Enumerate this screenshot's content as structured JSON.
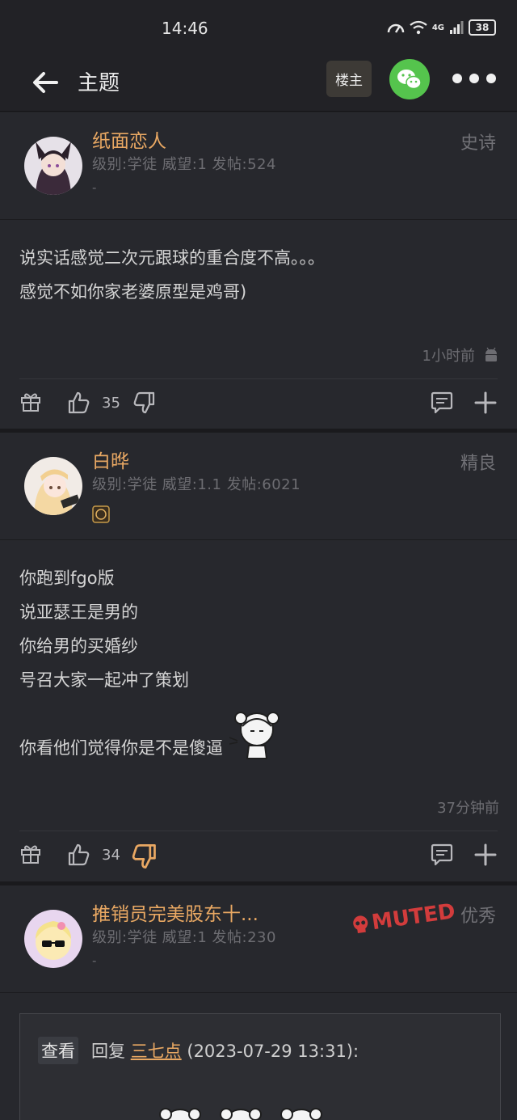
{
  "status_bar": {
    "time": "14:46",
    "network": "4G",
    "battery": "38"
  },
  "header": {
    "title": "主题",
    "op_button": "楼主"
  },
  "posts": [
    {
      "username": "纸面恋人",
      "meta": "级别:学徒 威望:1 发帖:524",
      "signature": "-",
      "rank": "史诗",
      "content": [
        "说实话感觉二次元跟球的重合度不高。。。",
        "感觉不如你家老婆原型是鸡哥)"
      ],
      "time": "1小时前",
      "likes": "35"
    },
    {
      "username": "白晔",
      "meta": "级别:学徒 威望:1.1 发帖:6021",
      "rank": "精良",
      "content": [
        "你跑到fgo版",
        "说亚瑟王是男的",
        "你给男的买婚纱",
        "号召大家一起冲了策划",
        "",
        "你看他们觉得你是不是傻逼"
      ],
      "time": "37分钟前",
      "likes": "34"
    },
    {
      "username": "推销员完美股东十...",
      "meta": "级别:学徒 威望:1 发帖:230",
      "signature": "-",
      "rank": "优秀",
      "muted_label": "MUTED"
    }
  ],
  "quote": {
    "view_label": "查看",
    "reply_prefix": "回复",
    "reply_user": "三七点",
    "reply_time": "(2023-07-29 13:31):"
  },
  "colors": {
    "accent": "#e9a863",
    "background": "#222226",
    "card": "#27282d",
    "wechat": "#55c44d",
    "muted": "#d23c3c"
  }
}
